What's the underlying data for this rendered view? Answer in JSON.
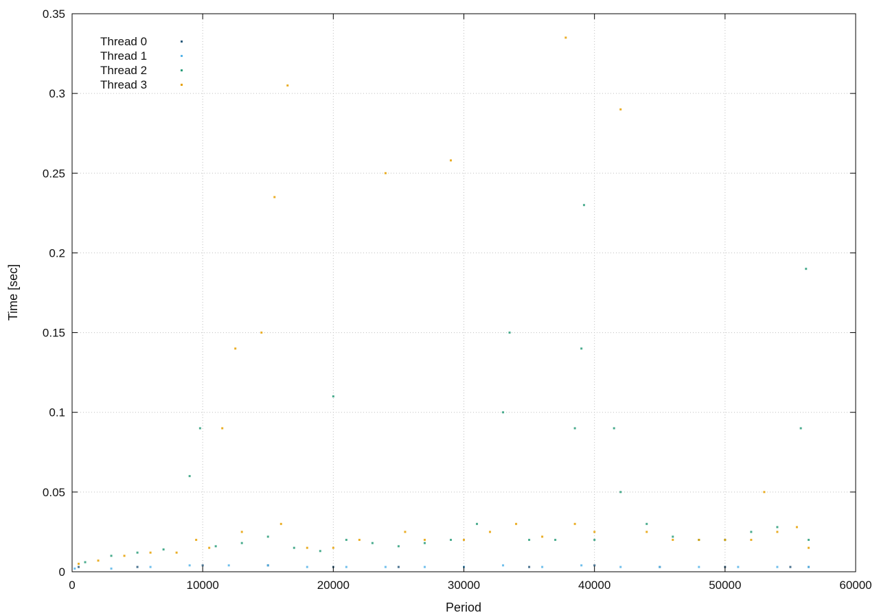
{
  "chart_data": {
    "type": "scatter",
    "title": "",
    "xlabel": "Period",
    "ylabel": "Time [sec]",
    "xlim": [
      0,
      60000
    ],
    "ylim": [
      0,
      0.35
    ],
    "x_ticks": [
      0,
      10000,
      20000,
      30000,
      40000,
      50000,
      60000
    ],
    "y_ticks": [
      0,
      0.05,
      0.1,
      0.15,
      0.2,
      0.25,
      0.3,
      0.35
    ],
    "x_tick_labels": [
      "0",
      "10000",
      "20000",
      "30000",
      "40000",
      "50000",
      "60000"
    ],
    "y_tick_labels": [
      "0",
      "0.05",
      "0.1",
      "0.15",
      "0.2",
      "0.25",
      "0.3",
      "0.35"
    ],
    "grid": true,
    "legend_position": "top-left",
    "series": [
      {
        "name": "Thread 0",
        "color": "#2a5b7c",
        "points": [
          [
            500,
            0.003
          ],
          [
            5000,
            0.003
          ],
          [
            10000,
            0.004
          ],
          [
            15000,
            0.004
          ],
          [
            20000,
            0.003
          ],
          [
            25000,
            0.003
          ],
          [
            30000,
            0.003
          ],
          [
            35000,
            0.003
          ],
          [
            40000,
            0.004
          ],
          [
            45000,
            0.003
          ],
          [
            50000,
            0.003
          ],
          [
            55000,
            0.003
          ],
          [
            56400,
            0.003
          ]
        ]
      },
      {
        "name": "Thread 1",
        "color": "#56b4e9",
        "points": [
          [
            200,
            0.002
          ],
          [
            3000,
            0.002
          ],
          [
            6000,
            0.003
          ],
          [
            9000,
            0.004
          ],
          [
            12000,
            0.004
          ],
          [
            15000,
            0.004
          ],
          [
            18000,
            0.003
          ],
          [
            21000,
            0.003
          ],
          [
            24000,
            0.003
          ],
          [
            27000,
            0.003
          ],
          [
            30000,
            0.003
          ],
          [
            33000,
            0.004
          ],
          [
            36000,
            0.003
          ],
          [
            39000,
            0.004
          ],
          [
            42000,
            0.003
          ],
          [
            45000,
            0.003
          ],
          [
            48000,
            0.003
          ],
          [
            51000,
            0.003
          ],
          [
            54000,
            0.003
          ],
          [
            56400,
            0.003
          ]
        ]
      },
      {
        "name": "Thread 2",
        "color": "#2a9d7a",
        "points": [
          [
            1000,
            0.006
          ],
          [
            3000,
            0.01
          ],
          [
            5000,
            0.012
          ],
          [
            7000,
            0.014
          ],
          [
            9000,
            0.06
          ],
          [
            9800,
            0.09
          ],
          [
            11000,
            0.016
          ],
          [
            13000,
            0.018
          ],
          [
            15000,
            0.022
          ],
          [
            17000,
            0.015
          ],
          [
            19000,
            0.013
          ],
          [
            20000,
            0.11
          ],
          [
            21000,
            0.02
          ],
          [
            23000,
            0.018
          ],
          [
            25000,
            0.016
          ],
          [
            27000,
            0.018
          ],
          [
            29000,
            0.02
          ],
          [
            31000,
            0.03
          ],
          [
            33000,
            0.1
          ],
          [
            33500,
            0.15
          ],
          [
            35000,
            0.02
          ],
          [
            37000,
            0.02
          ],
          [
            38500,
            0.09
          ],
          [
            39000,
            0.14
          ],
          [
            39200,
            0.23
          ],
          [
            40000,
            0.02
          ],
          [
            41500,
            0.09
          ],
          [
            42000,
            0.05
          ],
          [
            44000,
            0.03
          ],
          [
            46000,
            0.022
          ],
          [
            48000,
            0.02
          ],
          [
            50000,
            0.02
          ],
          [
            52000,
            0.025
          ],
          [
            54000,
            0.028
          ],
          [
            55800,
            0.09
          ],
          [
            56200,
            0.19
          ],
          [
            56400,
            0.02
          ]
        ]
      },
      {
        "name": "Thread 3",
        "color": "#e6a000",
        "points": [
          [
            500,
            0.005
          ],
          [
            2000,
            0.007
          ],
          [
            4000,
            0.01
          ],
          [
            6000,
            0.012
          ],
          [
            8000,
            0.012
          ],
          [
            9500,
            0.02
          ],
          [
            10500,
            0.015
          ],
          [
            11500,
            0.09
          ],
          [
            12500,
            0.14
          ],
          [
            13000,
            0.025
          ],
          [
            14500,
            0.15
          ],
          [
            15500,
            0.235
          ],
          [
            16000,
            0.03
          ],
          [
            16500,
            0.305
          ],
          [
            18000,
            0.015
          ],
          [
            20000,
            0.015
          ],
          [
            22000,
            0.02
          ],
          [
            24000,
            0.25
          ],
          [
            25500,
            0.025
          ],
          [
            27000,
            0.02
          ],
          [
            29000,
            0.258
          ],
          [
            30000,
            0.02
          ],
          [
            32000,
            0.025
          ],
          [
            34000,
            0.03
          ],
          [
            36000,
            0.022
          ],
          [
            37800,
            0.335
          ],
          [
            38500,
            0.03
          ],
          [
            40000,
            0.025
          ],
          [
            42000,
            0.29
          ],
          [
            44000,
            0.025
          ],
          [
            46000,
            0.02
          ],
          [
            48000,
            0.02
          ],
          [
            50000,
            0.02
          ],
          [
            52000,
            0.02
          ],
          [
            53000,
            0.05
          ],
          [
            54000,
            0.025
          ],
          [
            55500,
            0.028
          ],
          [
            56400,
            0.015
          ]
        ]
      }
    ]
  }
}
